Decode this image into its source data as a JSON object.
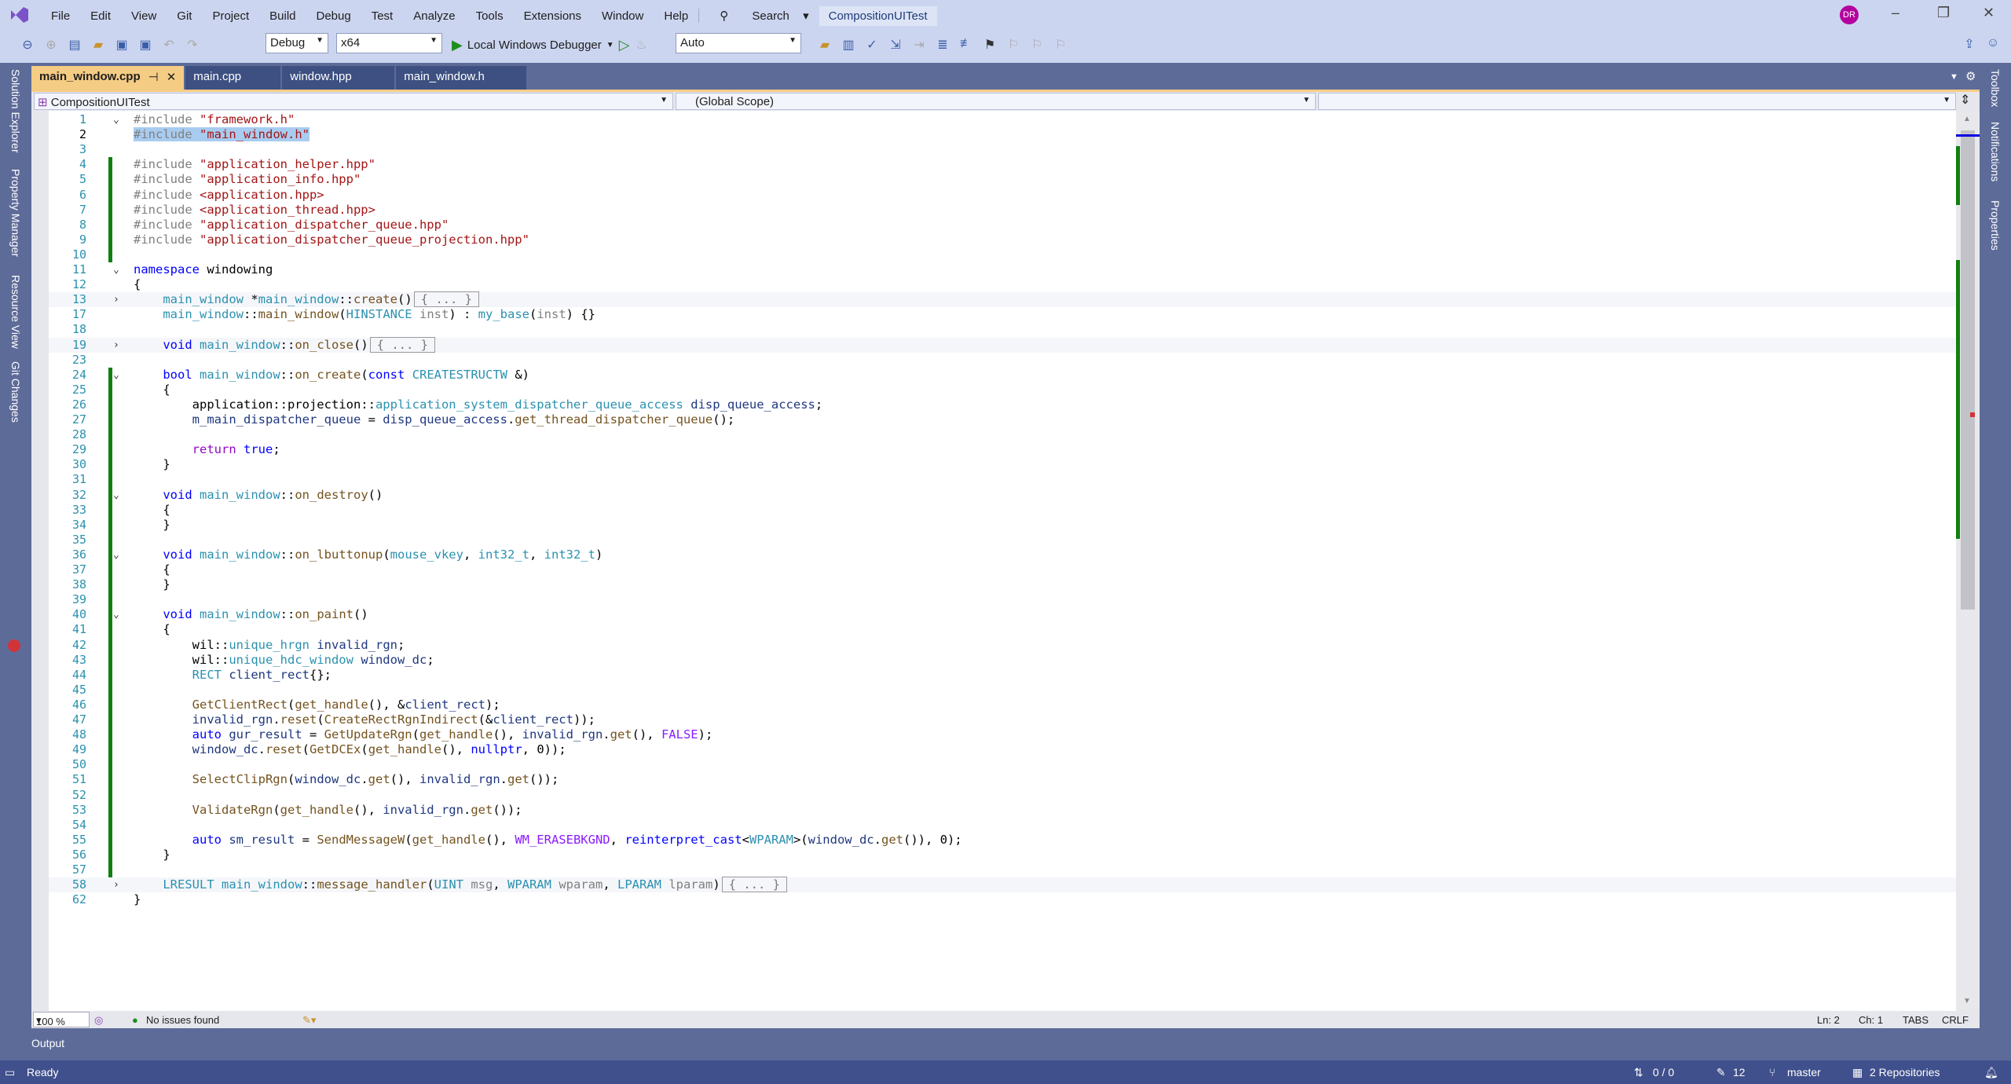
{
  "menu": [
    "File",
    "Edit",
    "View",
    "Git",
    "Project",
    "Build",
    "Debug",
    "Test",
    "Analyze",
    "Tools",
    "Extensions",
    "Window",
    "Help"
  ],
  "search_label": "Search",
  "project_title": "CompositionUITest",
  "avatar": "DR",
  "toolbar": {
    "config": "Debug",
    "platform": "x64",
    "debugger": "Local Windows Debugger",
    "solution_config": "Auto"
  },
  "tabs": [
    {
      "label": "main_window.cpp",
      "active": true
    },
    {
      "label": "main.cpp"
    },
    {
      "label": "window.hpp"
    },
    {
      "label": "main_window.h"
    }
  ],
  "nav": {
    "project": "CompositionUITest",
    "scope": "(Global Scope)",
    "member": ""
  },
  "left_dock": [
    "Solution Explorer",
    "Property Manager",
    "Resource View",
    "Git Changes"
  ],
  "right_dock": [
    "Toolbox",
    "Notifications",
    "Properties"
  ],
  "code": [
    {
      "n": 1,
      "f": "v",
      "t": [
        [
          "pp",
          "#include "
        ],
        [
          "str",
          "\"framework.h\""
        ]
      ]
    },
    {
      "n": 2,
      "sel": true,
      "t": [
        [
          "pp",
          "#include "
        ],
        [
          "str",
          "\"main_window.h\""
        ]
      ]
    },
    {
      "n": 3,
      "t": []
    },
    {
      "n": 4,
      "t": [
        [
          "pp",
          "#include "
        ],
        [
          "str",
          "\"application_helper.hpp\""
        ]
      ]
    },
    {
      "n": 5,
      "t": [
        [
          "pp",
          "#include "
        ],
        [
          "str",
          "\"application_info.hpp\""
        ]
      ]
    },
    {
      "n": 6,
      "t": [
        [
          "pp",
          "#include "
        ],
        [
          "str",
          "<application.hpp>"
        ]
      ]
    },
    {
      "n": 7,
      "t": [
        [
          "pp",
          "#include "
        ],
        [
          "str",
          "<application_thread.hpp>"
        ]
      ]
    },
    {
      "n": 8,
      "t": [
        [
          "pp",
          "#include "
        ],
        [
          "str",
          "\"application_dispatcher_queue.hpp\""
        ]
      ]
    },
    {
      "n": 9,
      "t": [
        [
          "pp",
          "#include "
        ],
        [
          "str",
          "\"application_dispatcher_queue_projection.hpp\""
        ]
      ]
    },
    {
      "n": 10,
      "t": []
    },
    {
      "n": 11,
      "f": "v",
      "t": [
        [
          "kw",
          "namespace"
        ],
        [
          "pl",
          " windowing"
        ]
      ]
    },
    {
      "n": 12,
      "t": [
        [
          "pl",
          "{"
        ]
      ]
    },
    {
      "n": 13,
      "f": ">",
      "c": true,
      "t": [
        [
          "pl",
          "    "
        ],
        [
          "ty",
          "main_window"
        ],
        [
          "pl",
          " *"
        ],
        [
          "ty",
          "main_window"
        ],
        [
          "pl",
          "::"
        ],
        [
          "fn",
          "create"
        ],
        [
          "pl",
          "()"
        ],
        [
          "box",
          "{ ... }"
        ]
      ]
    },
    {
      "n": 17,
      "t": [
        [
          "pl",
          "    "
        ],
        [
          "ty",
          "main_window"
        ],
        [
          "pl",
          "::"
        ],
        [
          "fn",
          "main_window"
        ],
        [
          "pl",
          "("
        ],
        [
          "ty",
          "HINSTANCE"
        ],
        [
          "prm",
          " inst"
        ],
        [
          "pl",
          ") : "
        ],
        [
          "ty",
          "my_base"
        ],
        [
          "pl",
          "("
        ],
        [
          "prm",
          "inst"
        ],
        [
          "pl",
          ") {}"
        ]
      ]
    },
    {
      "n": 18,
      "t": []
    },
    {
      "n": 19,
      "f": ">",
      "c": true,
      "t": [
        [
          "pl",
          "    "
        ],
        [
          "kw",
          "void"
        ],
        [
          "pl",
          " "
        ],
        [
          "ty",
          "main_window"
        ],
        [
          "pl",
          "::"
        ],
        [
          "fn",
          "on_close"
        ],
        [
          "pl",
          "()"
        ],
        [
          "box",
          "{ ... }"
        ]
      ]
    },
    {
      "n": 23,
      "t": []
    },
    {
      "n": 24,
      "f": "v",
      "t": [
        [
          "pl",
          "    "
        ],
        [
          "kw",
          "bool"
        ],
        [
          "pl",
          " "
        ],
        [
          "ty",
          "main_window"
        ],
        [
          "pl",
          "::"
        ],
        [
          "fn",
          "on_create"
        ],
        [
          "pl",
          "("
        ],
        [
          "kw",
          "const"
        ],
        [
          "pl",
          " "
        ],
        [
          "ty",
          "CREATESTRUCTW"
        ],
        [
          "pl",
          " &)"
        ]
      ]
    },
    {
      "n": 25,
      "t": [
        [
          "pl",
          "    {"
        ]
      ]
    },
    {
      "n": 26,
      "t": [
        [
          "pl",
          "        application::projection::"
        ],
        [
          "ty",
          "application_system_dispatcher_queue_access"
        ],
        [
          "pl",
          " "
        ],
        [
          "var",
          "disp_queue_access"
        ],
        [
          "pl",
          ";"
        ]
      ]
    },
    {
      "n": 27,
      "t": [
        [
          "pl",
          "        "
        ],
        [
          "var",
          "m_main_dispatcher_queue"
        ],
        [
          "pl",
          " = "
        ],
        [
          "var",
          "disp_queue_access"
        ],
        [
          "pl",
          "."
        ],
        [
          "fn",
          "get_thread_dispatcher_queue"
        ],
        [
          "pl",
          "();"
        ]
      ]
    },
    {
      "n": 28,
      "t": []
    },
    {
      "n": 29,
      "t": [
        [
          "pl",
          "        "
        ],
        [
          "ctl",
          "return"
        ],
        [
          "pl",
          " "
        ],
        [
          "kw",
          "true"
        ],
        [
          "pl",
          ";"
        ]
      ]
    },
    {
      "n": 30,
      "t": [
        [
          "pl",
          "    }"
        ]
      ]
    },
    {
      "n": 31,
      "t": []
    },
    {
      "n": 32,
      "f": "v",
      "t": [
        [
          "pl",
          "    "
        ],
        [
          "kw",
          "void"
        ],
        [
          "pl",
          " "
        ],
        [
          "ty",
          "main_window"
        ],
        [
          "pl",
          "::"
        ],
        [
          "fn",
          "on_destroy"
        ],
        [
          "pl",
          "()"
        ]
      ]
    },
    {
      "n": 33,
      "t": [
        [
          "pl",
          "    {"
        ]
      ]
    },
    {
      "n": 34,
      "t": [
        [
          "pl",
          "    }"
        ]
      ]
    },
    {
      "n": 35,
      "t": []
    },
    {
      "n": 36,
      "f": "v",
      "t": [
        [
          "pl",
          "    "
        ],
        [
          "kw",
          "void"
        ],
        [
          "pl",
          " "
        ],
        [
          "ty",
          "main_window"
        ],
        [
          "pl",
          "::"
        ],
        [
          "fn",
          "on_lbuttonup"
        ],
        [
          "pl",
          "("
        ],
        [
          "ty",
          "mouse_vkey"
        ],
        [
          "pl",
          ", "
        ],
        [
          "ty",
          "int32_t"
        ],
        [
          "pl",
          ", "
        ],
        [
          "ty",
          "int32_t"
        ],
        [
          "pl",
          ")"
        ]
      ]
    },
    {
      "n": 37,
      "t": [
        [
          "pl",
          "    {"
        ]
      ]
    },
    {
      "n": 38,
      "t": [
        [
          "pl",
          "    }"
        ]
      ]
    },
    {
      "n": 39,
      "t": []
    },
    {
      "n": 40,
      "f": "v",
      "t": [
        [
          "pl",
          "    "
        ],
        [
          "kw",
          "void"
        ],
        [
          "pl",
          " "
        ],
        [
          "ty",
          "main_window"
        ],
        [
          "pl",
          "::"
        ],
        [
          "fn",
          "on_paint"
        ],
        [
          "pl",
          "()"
        ]
      ]
    },
    {
      "n": 41,
      "t": [
        [
          "pl",
          "    {"
        ]
      ]
    },
    {
      "n": 42,
      "bp": true,
      "t": [
        [
          "pl",
          "        wil::"
        ],
        [
          "ty",
          "unique_hrgn"
        ],
        [
          "pl",
          " "
        ],
        [
          "var",
          "invalid_rgn"
        ],
        [
          "pl",
          ";"
        ]
      ]
    },
    {
      "n": 43,
      "t": [
        [
          "pl",
          "        wil::"
        ],
        [
          "ty",
          "unique_hdc_window"
        ],
        [
          "pl",
          " "
        ],
        [
          "var",
          "window_dc"
        ],
        [
          "pl",
          ";"
        ]
      ]
    },
    {
      "n": 44,
      "t": [
        [
          "pl",
          "        "
        ],
        [
          "ty",
          "RECT"
        ],
        [
          "pl",
          " "
        ],
        [
          "var",
          "client_rect"
        ],
        [
          "pl",
          "{};"
        ]
      ]
    },
    {
      "n": 45,
      "t": []
    },
    {
      "n": 46,
      "t": [
        [
          "pl",
          "        "
        ],
        [
          "fn",
          "GetClientRect"
        ],
        [
          "pl",
          "("
        ],
        [
          "fn",
          "get_handle"
        ],
        [
          "pl",
          "(), &"
        ],
        [
          "var",
          "client_rect"
        ],
        [
          "pl",
          ");"
        ]
      ]
    },
    {
      "n": 47,
      "t": [
        [
          "pl",
          "        "
        ],
        [
          "var",
          "invalid_rgn"
        ],
        [
          "pl",
          "."
        ],
        [
          "fn",
          "reset"
        ],
        [
          "pl",
          "("
        ],
        [
          "fn",
          "CreateRectRgnIndirect"
        ],
        [
          "pl",
          "(&"
        ],
        [
          "var",
          "client_rect"
        ],
        [
          "pl",
          "));"
        ]
      ]
    },
    {
      "n": 48,
      "t": [
        [
          "pl",
          "        "
        ],
        [
          "kw",
          "auto"
        ],
        [
          "pl",
          " "
        ],
        [
          "var",
          "gur_result"
        ],
        [
          "pl",
          " = "
        ],
        [
          "fn",
          "GetUpdateRgn"
        ],
        [
          "pl",
          "("
        ],
        [
          "fn",
          "get_handle"
        ],
        [
          "pl",
          "(), "
        ],
        [
          "var",
          "invalid_rgn"
        ],
        [
          "pl",
          "."
        ],
        [
          "fn",
          "get"
        ],
        [
          "pl",
          "(), "
        ],
        [
          "mac",
          "FALSE"
        ],
        [
          "pl",
          ");"
        ]
      ]
    },
    {
      "n": 49,
      "t": [
        [
          "pl",
          "        "
        ],
        [
          "var",
          "window_dc"
        ],
        [
          "pl",
          "."
        ],
        [
          "fn",
          "reset"
        ],
        [
          "pl",
          "("
        ],
        [
          "fn",
          "GetDCEx"
        ],
        [
          "pl",
          "("
        ],
        [
          "fn",
          "get_handle"
        ],
        [
          "pl",
          "(), "
        ],
        [
          "kw",
          "nullptr"
        ],
        [
          "pl",
          ", 0));"
        ]
      ]
    },
    {
      "n": 50,
      "t": []
    },
    {
      "n": 51,
      "t": [
        [
          "pl",
          "        "
        ],
        [
          "fn",
          "SelectClipRgn"
        ],
        [
          "pl",
          "("
        ],
        [
          "var",
          "window_dc"
        ],
        [
          "pl",
          "."
        ],
        [
          "fn",
          "get"
        ],
        [
          "pl",
          "(), "
        ],
        [
          "var",
          "invalid_rgn"
        ],
        [
          "pl",
          "."
        ],
        [
          "fn",
          "get"
        ],
        [
          "pl",
          "());"
        ]
      ]
    },
    {
      "n": 52,
      "t": []
    },
    {
      "n": 53,
      "t": [
        [
          "pl",
          "        "
        ],
        [
          "fn",
          "ValidateRgn"
        ],
        [
          "pl",
          "("
        ],
        [
          "fn",
          "get_handle"
        ],
        [
          "pl",
          "(), "
        ],
        [
          "var",
          "invalid_rgn"
        ],
        [
          "pl",
          "."
        ],
        [
          "fn",
          "get"
        ],
        [
          "pl",
          "());"
        ]
      ]
    },
    {
      "n": 54,
      "t": []
    },
    {
      "n": 55,
      "t": [
        [
          "pl",
          "        "
        ],
        [
          "kw",
          "auto"
        ],
        [
          "pl",
          " "
        ],
        [
          "var",
          "sm_result"
        ],
        [
          "pl",
          " = "
        ],
        [
          "fn",
          "SendMessageW"
        ],
        [
          "pl",
          "("
        ],
        [
          "fn",
          "get_handle"
        ],
        [
          "pl",
          "(), "
        ],
        [
          "mac",
          "WM_ERASEBKGND"
        ],
        [
          "pl",
          ", "
        ],
        [
          "kw",
          "reinterpret_cast"
        ],
        [
          "pl",
          "<"
        ],
        [
          "ty",
          "WPARAM"
        ],
        [
          "pl",
          ">("
        ],
        [
          "var",
          "window_dc"
        ],
        [
          "pl",
          "."
        ],
        [
          "fn",
          "get"
        ],
        [
          "pl",
          "()), 0);"
        ]
      ]
    },
    {
      "n": 56,
      "t": [
        [
          "pl",
          "    }"
        ]
      ]
    },
    {
      "n": 57,
      "t": []
    },
    {
      "n": 58,
      "f": ">",
      "c": true,
      "t": [
        [
          "pl",
          "    "
        ],
        [
          "ty",
          "LRESULT"
        ],
        [
          "pl",
          " "
        ],
        [
          "ty",
          "main_window"
        ],
        [
          "pl",
          "::"
        ],
        [
          "fn",
          "message_handler"
        ],
        [
          "pl",
          "("
        ],
        [
          "ty",
          "UINT"
        ],
        [
          "prm",
          " msg"
        ],
        [
          "pl",
          ", "
        ],
        [
          "ty",
          "WPARAM"
        ],
        [
          "prm",
          " wparam"
        ],
        [
          "pl",
          ", "
        ],
        [
          "ty",
          "LPARAM"
        ],
        [
          "prm",
          " lparam"
        ],
        [
          "pl",
          ")"
        ],
        [
          "box",
          "{ ... }"
        ]
      ]
    },
    {
      "n": 62,
      "t": [
        [
          "pl",
          "}"
        ]
      ]
    }
  ],
  "editor_status": {
    "zoom": "100 %",
    "issues": "No issues found",
    "line": "Ln: 2",
    "col": "Ch: 1",
    "tabs": "TABS",
    "eol": "CRLF"
  },
  "output_label": "Output",
  "status": {
    "ready": "Ready",
    "sync": "0 / 0",
    "edits": "12",
    "branch": "master",
    "repos": "2 Repositories"
  }
}
